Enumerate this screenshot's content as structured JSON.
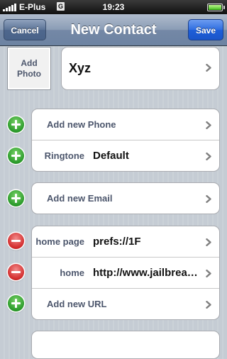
{
  "status_bar": {
    "carrier": "E-Plus",
    "network": "G",
    "time": "19:23",
    "signal_bars": 5,
    "battery_level": 1.0
  },
  "nav": {
    "title": "New Contact",
    "cancel_label": "Cancel",
    "save_label": "Save"
  },
  "photo": {
    "label": "Add Photo"
  },
  "name": {
    "value": "Xyz"
  },
  "sections": {
    "phone": {
      "add_phone_label": "Add new Phone",
      "ringtone_label": "Ringtone",
      "ringtone_value": "Default"
    },
    "email": {
      "add_email_label": "Add new Email"
    },
    "urls": {
      "rows": [
        {
          "label": "home page",
          "value": "prefs://1F"
        },
        {
          "label": "home",
          "value": "http://www.jailbreakme.com"
        }
      ],
      "add_url_label": "Add new URL"
    }
  },
  "colors": {
    "label_text": "#4c566c",
    "nav_bar": "#6d83a2",
    "save_button": "#1e5fd9",
    "add_button": "#2a9a2a",
    "remove_button": "#d22b2b"
  }
}
